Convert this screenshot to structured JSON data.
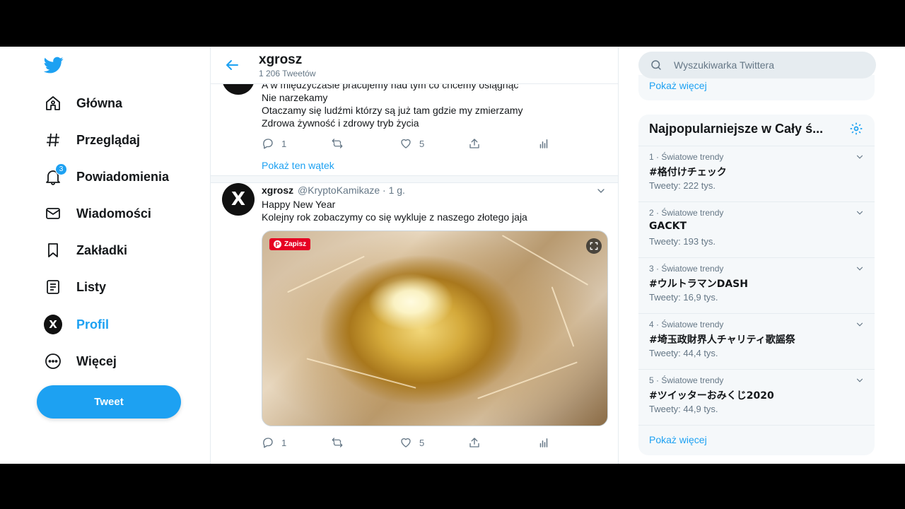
{
  "nav": {
    "items": [
      {
        "label": "Główna",
        "icon": "home-icon"
      },
      {
        "label": "Przeglądaj",
        "icon": "hashtag-icon"
      },
      {
        "label": "Powiadomienia",
        "icon": "bell-icon",
        "badge": "3"
      },
      {
        "label": "Wiadomości",
        "icon": "mail-icon"
      },
      {
        "label": "Zakładki",
        "icon": "bookmark-icon"
      },
      {
        "label": "Listy",
        "icon": "list-icon"
      },
      {
        "label": "Profil",
        "icon": "profile-avatar",
        "active": true
      },
      {
        "label": "Więcej",
        "icon": "more-icon"
      }
    ],
    "tweet_button": "Tweet",
    "accent": "#1da1f2"
  },
  "header": {
    "title": "xgrosz",
    "subtitle": "1 206 Tweetów"
  },
  "tweet1": {
    "lines": "A w międzyczasie pracujemy nad tym co chcemy osiągnąć\nNie narzekamy\nOtaczamy się ludźmi którzy są już tam gdzie my zmierzamy\nZdrowa żywność i zdrowy tryb życia",
    "replies": "1",
    "likes": "5",
    "thread_link": "Pokaż ten wątek"
  },
  "tweet2": {
    "name": "xgrosz",
    "handle": "@KryptoKamikaze · 1 g.",
    "text": "Happy New Year\nKolejny rok zobaczymy co się wykluje z naszego złotego jaja",
    "avatar_letter": "X",
    "pin_label": "Zapisz",
    "replies": "1",
    "likes": "5"
  },
  "sidebar": {
    "search_placeholder": "Wyszukiwarka Twittera",
    "top_more": "Pokaż więcej",
    "trends_title": "Najpopularniejsze w Cały ś...",
    "trends": [
      {
        "meta": "1 · Światowe trendy",
        "name": "#格付けチェック",
        "count": "Tweety: 222 tys."
      },
      {
        "meta": "2 · Światowe trendy",
        "name": "GACKT",
        "count": "Tweety: 193 tys."
      },
      {
        "meta": "3 · Światowe trendy",
        "name": "#ウルトラマンDASH",
        "count": "Tweety: 16,9 tys."
      },
      {
        "meta": "4 · Światowe trendy",
        "name": "#埼玉政財界人チャリティ歌謡祭",
        "count": "Tweety: 44,4 tys."
      },
      {
        "meta": "5 · Światowe trendy",
        "name": "#ツイッターおみくじ2020",
        "count": "Tweety: 44,9 tys."
      }
    ],
    "more": "Pokaż więcej"
  }
}
